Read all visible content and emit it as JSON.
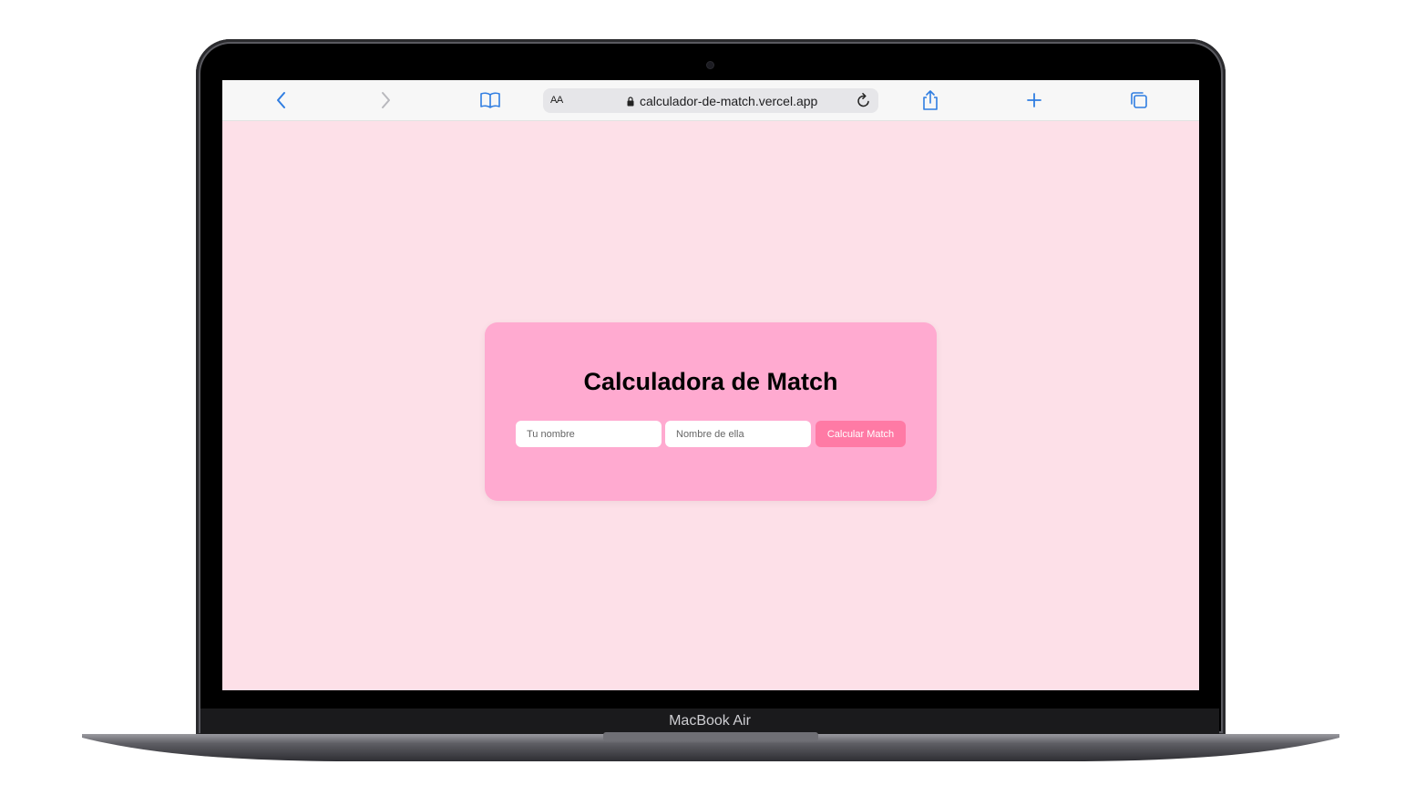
{
  "device": {
    "model_label": "MacBook Air"
  },
  "browser": {
    "text_size_label": "AA",
    "url": "calculador-de-match.vercel.app",
    "accent_color": "#2f7de1"
  },
  "app": {
    "title": "Calculadora de Match",
    "your_name_placeholder": "Tu nombre",
    "her_name_placeholder": "Nombre de ella",
    "submit_label": "Calcular Match",
    "background_color": "#fde0e8",
    "card_color": "#ffaad0",
    "button_color": "#ff7aa5"
  }
}
